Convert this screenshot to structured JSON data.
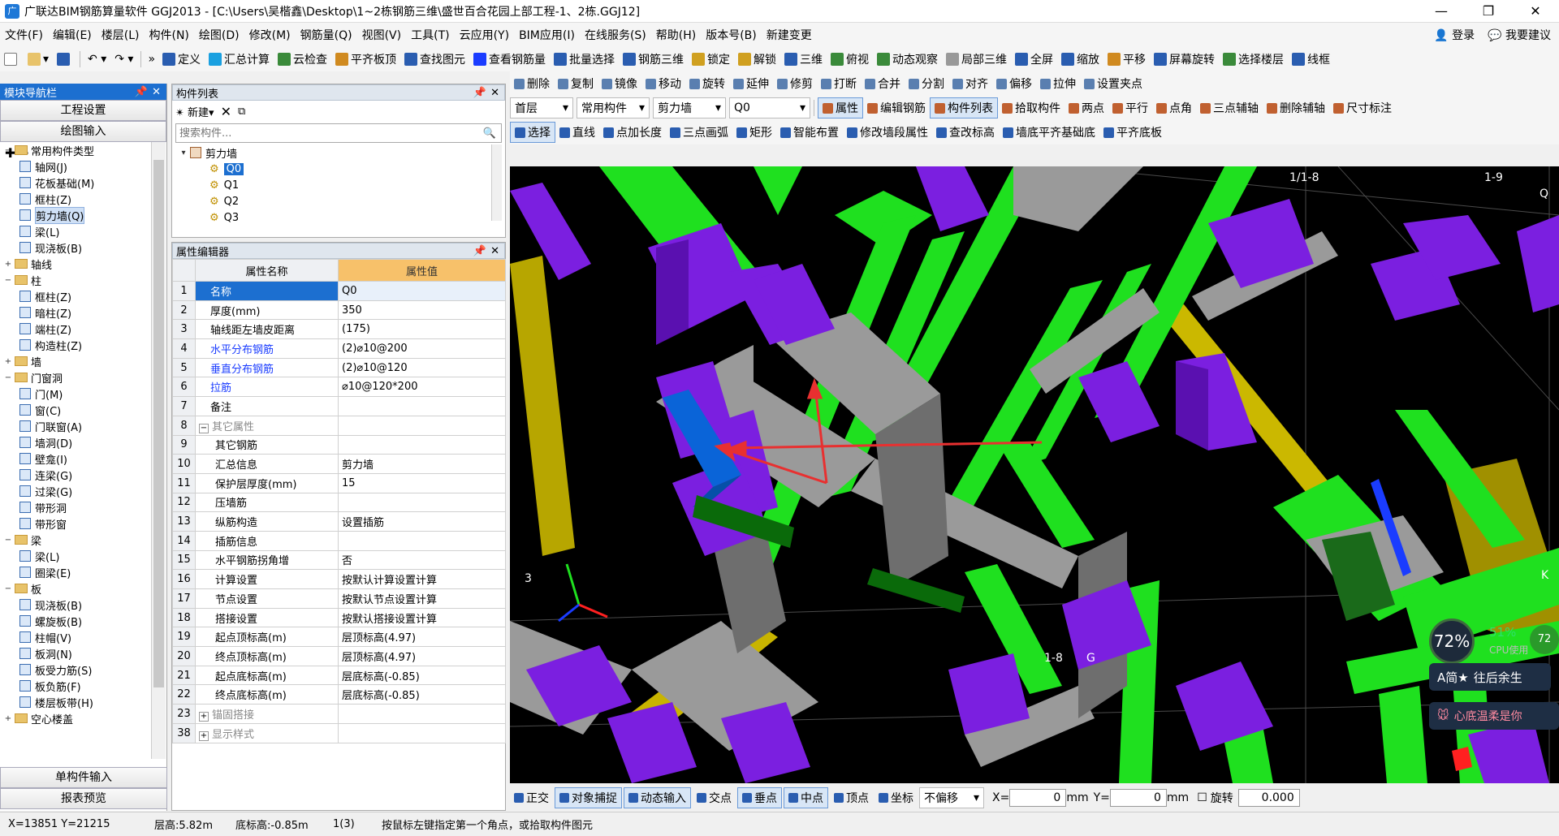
{
  "window": {
    "title": "广联达BIM钢筋算量软件 GGJ2013 - [C:\\Users\\吴楷鑫\\Desktop\\1~2栋钢筋三维\\盛世百合花园上部工程-1、2栋.GGJ12]"
  },
  "menu": [
    "文件(F)",
    "编辑(E)",
    "楼层(L)",
    "构件(N)",
    "绘图(D)",
    "修改(M)",
    "钢筋量(Q)",
    "视图(V)",
    "工具(T)",
    "云应用(Y)",
    "BIM应用(I)",
    "在线服务(S)",
    "帮助(H)",
    "版本号(B)",
    "新建变更"
  ],
  "menu_right": {
    "login": "登录",
    "suggest": "我要建议"
  },
  "toolbar1": [
    "定义",
    "汇总计算",
    "云检查",
    "平齐板顶",
    "查找图元",
    "查看钢筋量",
    "批量选择",
    "钢筋三维",
    "锁定",
    "解锁",
    "三维",
    "俯视",
    "动态观察",
    "局部三维",
    "全屏",
    "缩放",
    "平移",
    "屏幕旋转",
    "选择楼层",
    "线框"
  ],
  "toolbar2": [
    "删除",
    "复制",
    "镜像",
    "移动",
    "旋转",
    "延伸",
    "修剪",
    "打断",
    "合并",
    "分割",
    "对齐",
    "偏移",
    "拉伸",
    "设置夹点"
  ],
  "toolbar3": {
    "floor": "首层",
    "category": "常用构件",
    "type": "剪力墙",
    "component": "Q0",
    "buttons": [
      "属性",
      "编辑钢筋",
      "构件列表",
      "拾取构件",
      "两点",
      "平行",
      "点角",
      "三点辅轴",
      "删除辅轴",
      "尺寸标注"
    ]
  },
  "toolbar4": [
    "选择",
    "直线",
    "点加长度",
    "三点画弧",
    "矩形",
    "智能布置",
    "修改墙段属性",
    "查改标高",
    "墙底平齐基础底",
    "平齐底板"
  ],
  "nav": {
    "title": "模块导航栏",
    "buttons": [
      "工程设置",
      "绘图输入"
    ],
    "tree": [
      {
        "label": "常用构件类型",
        "level": 0,
        "type": "folder",
        "exp": "−"
      },
      {
        "label": "轴网(J)",
        "level": 1,
        "type": "leaf"
      },
      {
        "label": "花板基础(M)",
        "level": 1,
        "type": "leaf"
      },
      {
        "label": "框柱(Z)",
        "level": 1,
        "type": "leaf"
      },
      {
        "label": "剪力墙(Q)",
        "level": 1,
        "type": "leaf",
        "sel": true
      },
      {
        "label": "梁(L)",
        "level": 1,
        "type": "leaf"
      },
      {
        "label": "现浇板(B)",
        "level": 1,
        "type": "leaf"
      },
      {
        "label": "轴线",
        "level": 0,
        "type": "folder",
        "exp": "+"
      },
      {
        "label": "柱",
        "level": 0,
        "type": "folder",
        "exp": "−"
      },
      {
        "label": "框柱(Z)",
        "level": 1,
        "type": "leaf"
      },
      {
        "label": "暗柱(Z)",
        "level": 1,
        "type": "leaf"
      },
      {
        "label": "端柱(Z)",
        "level": 1,
        "type": "leaf"
      },
      {
        "label": "构造柱(Z)",
        "level": 1,
        "type": "leaf"
      },
      {
        "label": "墙",
        "level": 0,
        "type": "folder",
        "exp": "+"
      },
      {
        "label": "门窗洞",
        "level": 0,
        "type": "folder",
        "exp": "−"
      },
      {
        "label": "门(M)",
        "level": 1,
        "type": "leaf"
      },
      {
        "label": "窗(C)",
        "level": 1,
        "type": "leaf"
      },
      {
        "label": "门联窗(A)",
        "level": 1,
        "type": "leaf"
      },
      {
        "label": "墙洞(D)",
        "level": 1,
        "type": "leaf"
      },
      {
        "label": "壁龛(I)",
        "level": 1,
        "type": "leaf"
      },
      {
        "label": "连梁(G)",
        "level": 1,
        "type": "leaf"
      },
      {
        "label": "过梁(G)",
        "level": 1,
        "type": "leaf"
      },
      {
        "label": "带形洞",
        "level": 1,
        "type": "leaf"
      },
      {
        "label": "带形窗",
        "level": 1,
        "type": "leaf"
      },
      {
        "label": "梁",
        "level": 0,
        "type": "folder",
        "exp": "−"
      },
      {
        "label": "梁(L)",
        "level": 1,
        "type": "leaf"
      },
      {
        "label": "圈梁(E)",
        "level": 1,
        "type": "leaf"
      },
      {
        "label": "板",
        "level": 0,
        "type": "folder",
        "exp": "−"
      },
      {
        "label": "现浇板(B)",
        "level": 1,
        "type": "leaf"
      },
      {
        "label": "螺旋板(B)",
        "level": 1,
        "type": "leaf"
      },
      {
        "label": "柱帽(V)",
        "level": 1,
        "type": "leaf"
      },
      {
        "label": "板洞(N)",
        "level": 1,
        "type": "leaf"
      },
      {
        "label": "板受力筋(S)",
        "level": 1,
        "type": "leaf"
      },
      {
        "label": "板负筋(F)",
        "level": 1,
        "type": "leaf"
      },
      {
        "label": "楼层板带(H)",
        "level": 1,
        "type": "leaf"
      },
      {
        "label": "空心楼盖",
        "level": 0,
        "type": "folder",
        "exp": "+"
      }
    ],
    "bottom_buttons": [
      "单构件输入",
      "报表预览"
    ]
  },
  "complist": {
    "title": "构件列表",
    "new_label": "新建",
    "search_placeholder": "搜索构件...",
    "group": "剪力墙",
    "items": [
      "Q0",
      "Q1",
      "Q2",
      "Q3"
    ]
  },
  "props": {
    "title": "属性编辑器",
    "col_name": "属性名称",
    "col_value": "属性值",
    "rows": [
      {
        "n": "1",
        "name": "名称",
        "value": "Q0",
        "style": "sel"
      },
      {
        "n": "2",
        "name": "厚度(mm)",
        "value": "350"
      },
      {
        "n": "3",
        "name": "轴线距左墙皮距离",
        "value": "(175)"
      },
      {
        "n": "4",
        "name": "水平分布钢筋",
        "value": "(2)⌀10@200",
        "style": "blue"
      },
      {
        "n": "5",
        "name": "垂直分布钢筋",
        "value": "(2)⌀10@120",
        "style": "blue"
      },
      {
        "n": "6",
        "name": "拉筋",
        "value": "⌀10@120*200",
        "style": "blue"
      },
      {
        "n": "7",
        "name": "备注",
        "value": ""
      },
      {
        "n": "8",
        "name": "其它属性",
        "value": "",
        "style": "gray",
        "exp": "−"
      },
      {
        "n": "9",
        "name": "其它钢筋",
        "value": "",
        "indent": true
      },
      {
        "n": "10",
        "name": "汇总信息",
        "value": "剪力墙",
        "indent": true
      },
      {
        "n": "11",
        "name": "保护层厚度(mm)",
        "value": "15",
        "indent": true
      },
      {
        "n": "12",
        "name": "压墙筋",
        "value": "",
        "indent": true
      },
      {
        "n": "13",
        "name": "纵筋构造",
        "value": "设置插筋",
        "indent": true
      },
      {
        "n": "14",
        "name": "插筋信息",
        "value": "",
        "indent": true
      },
      {
        "n": "15",
        "name": "水平钢筋拐角增",
        "value": "否",
        "indent": true
      },
      {
        "n": "16",
        "name": "计算设置",
        "value": "按默认计算设置计算",
        "indent": true
      },
      {
        "n": "17",
        "name": "节点设置",
        "value": "按默认节点设置计算",
        "indent": true
      },
      {
        "n": "18",
        "name": "搭接设置",
        "value": "按默认搭接设置计算",
        "indent": true
      },
      {
        "n": "19",
        "name": "起点顶标高(m)",
        "value": "层顶标高(4.97)",
        "indent": true
      },
      {
        "n": "20",
        "name": "终点顶标高(m)",
        "value": "层顶标高(4.97)",
        "indent": true
      },
      {
        "n": "21",
        "name": "起点底标高(m)",
        "value": "层底标高(-0.85)",
        "indent": true
      },
      {
        "n": "22",
        "name": "终点底标高(m)",
        "value": "层底标高(-0.85)",
        "indent": true
      },
      {
        "n": "23",
        "name": "锚固搭接",
        "value": "",
        "style": "gray",
        "exp": "+"
      },
      {
        "n": "38",
        "name": "显示样式",
        "value": "",
        "style": "gray",
        "exp": "+"
      }
    ]
  },
  "viewport": {
    "labels": [
      "1/1-8",
      "1-9",
      "Q",
      "1-8",
      "G",
      "K",
      "3"
    ]
  },
  "overlay": {
    "percent": "72%",
    "cpu": "51%",
    "cpu_label": "CPU使用",
    "badge": "72",
    "name1": "往后余生",
    "name2": "心底温柔是你"
  },
  "bottombar": {
    "buttons": [
      "正交",
      "对象捕捉",
      "动态输入",
      "交点",
      "垂点",
      "中点",
      "顶点",
      "坐标"
    ],
    "offset": "不偏移",
    "x_label": "X=",
    "x": "0",
    "y_label": "Y=",
    "y": "0",
    "unit": "mm",
    "rotate_label": "旋转",
    "rotate": "0.000"
  },
  "status": {
    "coords": "X=13851 Y=21215",
    "floor_h": "层高:5.82m",
    "bottom_h": "底标高:-0.85m",
    "count": "1(3)",
    "hint": "按鼠标左键指定第一个角点，或拾取构件图元"
  },
  "colors": {
    "purple": "#7b1fe0",
    "green": "#1fe01f",
    "gray": "#9a9a9a",
    "yellow": "#c8b400",
    "blue": "#0a64d8"
  }
}
